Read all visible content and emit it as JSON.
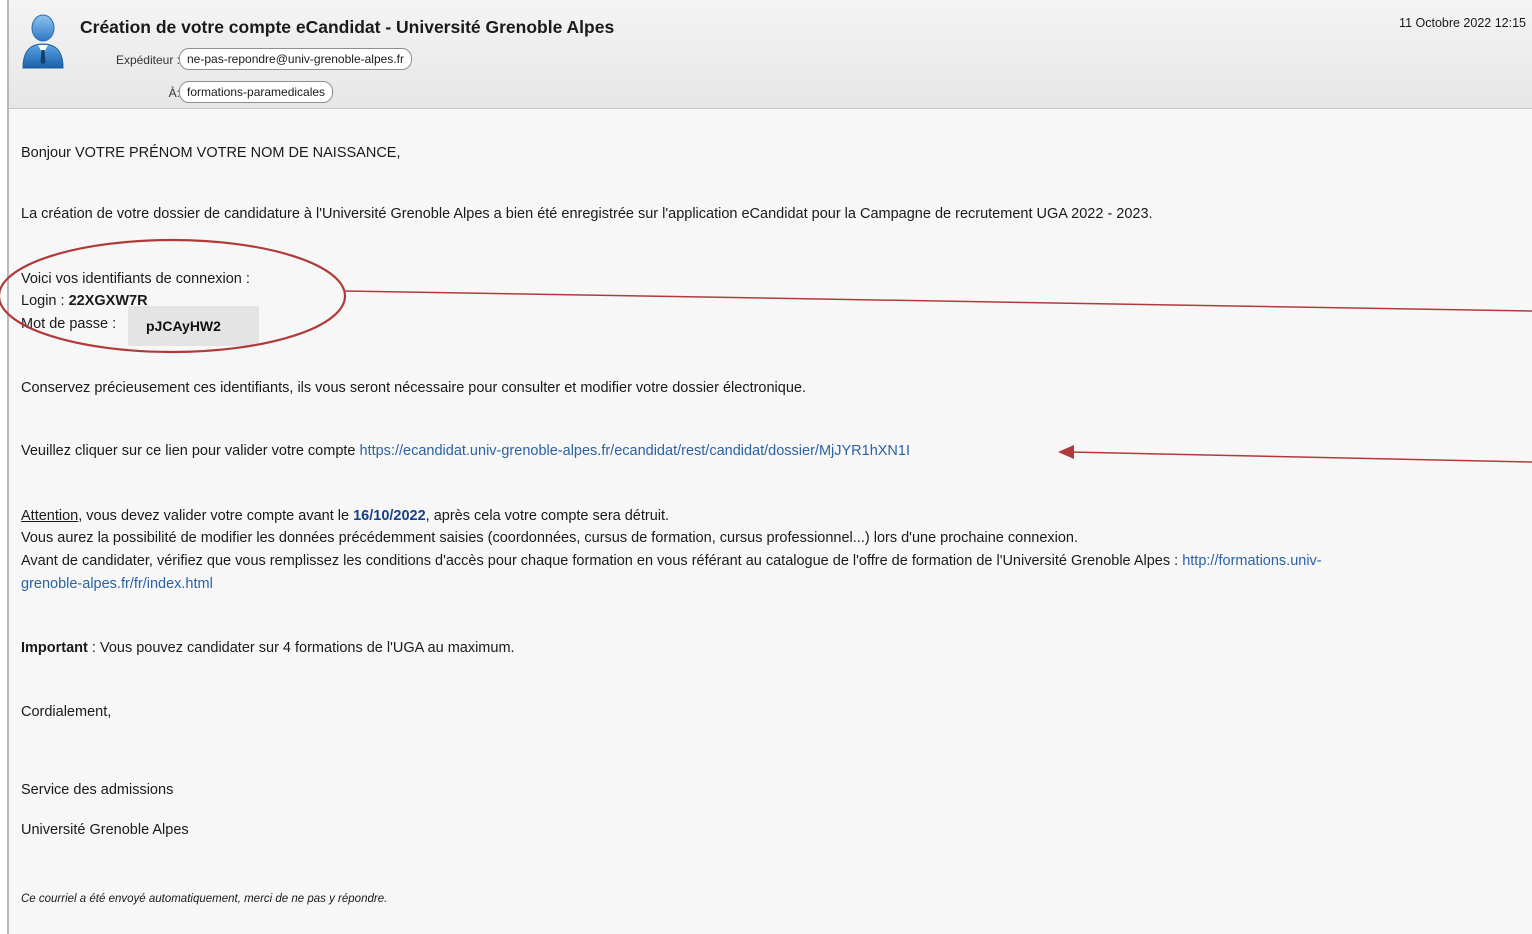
{
  "header": {
    "subject": "Création de votre compte eCandidat - Université Grenoble Alpes",
    "date": "11 Octobre 2022 12:15",
    "from_label": "Expéditeur :",
    "from_value": "ne-pas-repondre@univ-grenoble-alpes.fr",
    "to_label": "À:",
    "to_value": "formations-paramedicales",
    "avatar_icon": "user-avatar-icon"
  },
  "body": {
    "greeting": "Bonjour VOTRE PRÉNOM VOTRE NOM DE NAISSANCE,",
    "creation": "La création de votre dossier de candidature à l'Université Grenoble Alpes a bien été enregistrée sur l'application eCandidat pour la Campagne de recrutement UGA 2022 - 2023.",
    "ids_intro": "Voici vos identifiants de connexion :",
    "login_label": "Login : ",
    "login_value": "22XGXW7R",
    "password_label": "Mot de passe : ",
    "password_value": "pJCAyHW2",
    "keep": "Conservez précieusement ces identifiants, ils vous seront nécessaire pour consulter et modifier votre dossier électronique.",
    "validate_text": "Veuillez cliquer sur ce lien pour valider votre compte ",
    "validate_link": "https://ecandidat.univ-grenoble-alpes.fr/ecandidat/rest/candidat/dossier/MjJYR1hXN1I",
    "attention_word": "Attention",
    "attention_rest": ", vous devez valider votre compte avant le ",
    "deadline": "16/10/2022",
    "attention_end": ", après cela votre compte sera détruit.",
    "modify": "Vous aurez la possibilité de modifier les données précédemment saisies (coordonnées, cursus de formation, cursus professionnel...) lors d'une prochaine connexion.",
    "before_text": "Avant de candidater, vérifiez que vous remplissez les conditions d'accès pour chaque formation en vous référant au catalogue de l'offre de formation de l'Université Grenoble Alpes : ",
    "catalog_link_part1": "http://formations.univ-",
    "catalog_link_part2": "grenoble-alpes.fr/fr/index.html",
    "important_word": "Important",
    "important_rest": " : Vous pouvez candidater sur 4 formations de l'UGA au maximum.",
    "closing": "Cordialement,",
    "sig1": "Service des admissions",
    "sig2": "Université Grenoble Alpes",
    "auto_note": "Ce courriel a été envoyé automatiquement, merci de ne pas y répondre."
  },
  "colors": {
    "annotation": "#b03a3a",
    "link": "#2a62a6",
    "deadline": "#1a3f86"
  }
}
